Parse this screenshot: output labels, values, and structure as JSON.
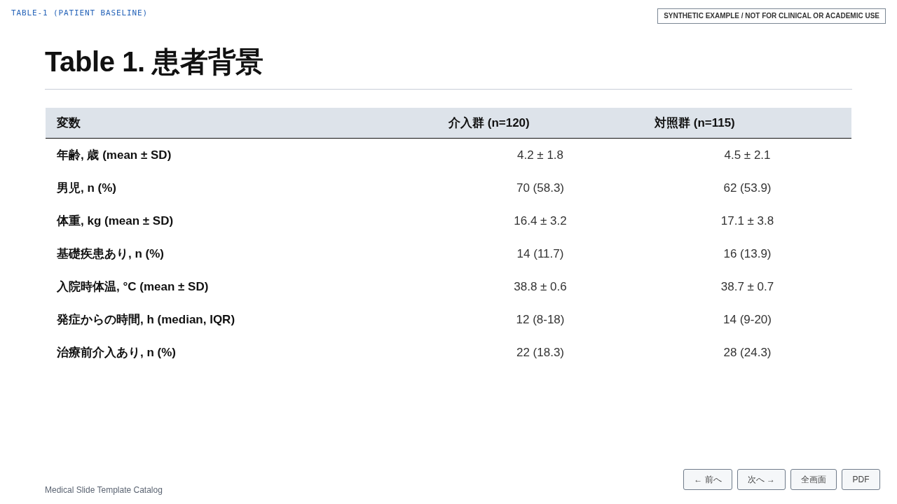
{
  "slide_label": "TABLE-1 (PATIENT BASELINE)",
  "notice": "SYNTHETIC EXAMPLE / NOT FOR CLINICAL OR ACADEMIC USE",
  "title": "Table 1. 患者背景",
  "table": {
    "columns": [
      "変数",
      "介入群 (n=120)",
      "対照群 (n=115)"
    ],
    "rows": [
      {
        "variable": "年齢, 歳 (mean ± SD)",
        "intervention": "4.2 ± 1.8",
        "control": "4.5 ± 2.1"
      },
      {
        "variable": "男児, n (%)",
        "intervention": "70 (58.3)",
        "control": "62 (53.9)"
      },
      {
        "variable": "体重, kg (mean ± SD)",
        "intervention": "16.4 ± 3.2",
        "control": "17.1 ± 3.8"
      },
      {
        "variable": "基礎疾患あり, n (%)",
        "intervention": "14 (11.7)",
        "control": "16 (13.9)"
      },
      {
        "variable": "入院時体温, °C (mean ± SD)",
        "intervention": "38.8 ± 0.6",
        "control": "38.7 ± 0.7"
      },
      {
        "variable": "発症からの時間, h (median, IQR)",
        "intervention": "12 (8-18)",
        "control": "14 (9-20)"
      },
      {
        "variable": "治療前介入あり, n (%)",
        "intervention": "22 (18.3)",
        "control": "28 (24.3)"
      }
    ]
  },
  "footer": "Medical Slide Template Catalog",
  "buttons": [
    "← 前へ",
    "次へ →",
    "全画面",
    "PDF"
  ]
}
